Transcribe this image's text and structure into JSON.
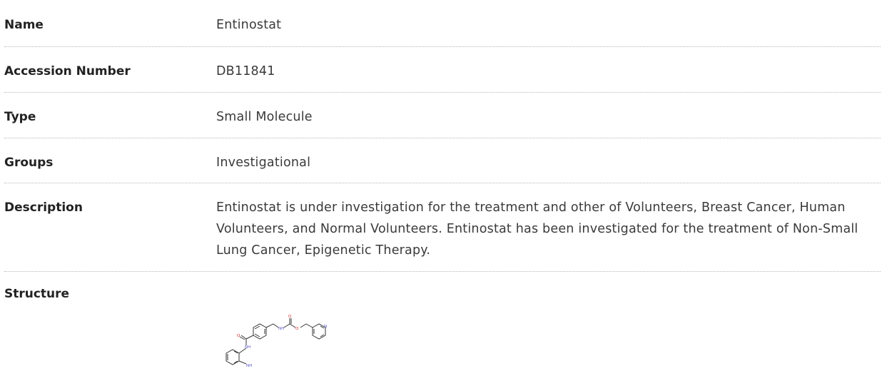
{
  "rows": {
    "name": {
      "label": "Name",
      "value": "Entinostat"
    },
    "accession": {
      "label": "Accession Number",
      "value": "DB11841"
    },
    "type": {
      "label": "Type",
      "value": "Small Molecule"
    },
    "groups": {
      "label": "Groups",
      "value": "Investigational"
    },
    "description": {
      "label": "Description",
      "value": "Entinostat is under investigation for the treatment and other of Volunteers, Breast Cancer, Human Volunteers, and Normal Volunteers. Entinostat has been investigated for the treatment of Non-Small Lung Cancer, Epigenetic Therapy."
    },
    "structure": {
      "label": "Structure",
      "atoms": {
        "o1": "O",
        "nh1": "NH",
        "nh2": "NH",
        "nh3": "NH",
        "o2": "O",
        "o3": "O",
        "n1": "N"
      }
    }
  },
  "colors": {
    "oxygen": "#d22424",
    "nitrogen": "#5a5ac8",
    "bond": "#333333",
    "divider": "#b8b8b8"
  }
}
